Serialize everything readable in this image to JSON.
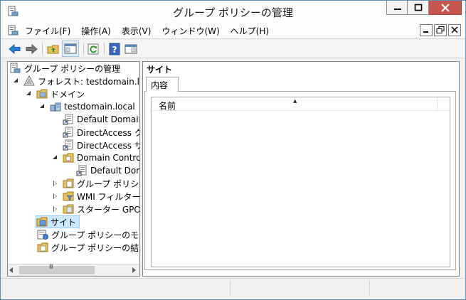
{
  "window": {
    "title": "グループ ポリシーの管理"
  },
  "menu": {
    "items": [
      "ファイル(F)",
      "操作(A)",
      "表示(V)",
      "ウィンドウ(W)",
      "ヘルプ(H)"
    ]
  },
  "tree": {
    "items": [
      {
        "label": "グループ ポリシーの管理",
        "icon": "gpmc-icon"
      },
      {
        "label": "フォレスト: testdomain.local",
        "icon": "forest-icon"
      },
      {
        "label": "ドメイン",
        "icon": "domains-folder-icon"
      },
      {
        "label": "testdomain.local",
        "icon": "domain-icon"
      },
      {
        "label": "Default Domain Policy",
        "icon": "gpo-link-icon"
      },
      {
        "label": "DirectAccess クライアントの設定",
        "icon": "gpo-link-icon"
      },
      {
        "label": "DirectAccess サーバーの設定",
        "icon": "gpo-link-icon"
      },
      {
        "label": "Domain Controllers",
        "icon": "ou-folder-icon"
      },
      {
        "label": "Default Domain Controllers Policy",
        "icon": "gpo-link-icon"
      },
      {
        "label": "グループ ポリシー オブジェクト",
        "icon": "gpo-folder-icon"
      },
      {
        "label": "WMI フィルター",
        "icon": "wmi-folder-icon"
      },
      {
        "label": "スターター GPO",
        "icon": "starter-gpo-folder-icon"
      },
      {
        "label": "サイト",
        "icon": "sites-icon"
      },
      {
        "label": "グループ ポリシーのモデル作成",
        "icon": "modeling-icon"
      },
      {
        "label": "グループ ポリシーの結果",
        "icon": "results-icon"
      }
    ]
  },
  "detail": {
    "title": "サイト",
    "tab": "内容",
    "columns": [
      "名前"
    ]
  },
  "colors": {
    "selection": "#cce8ff",
    "close_button": "#c7544e",
    "arrow_blue": "#2b7fd1"
  }
}
